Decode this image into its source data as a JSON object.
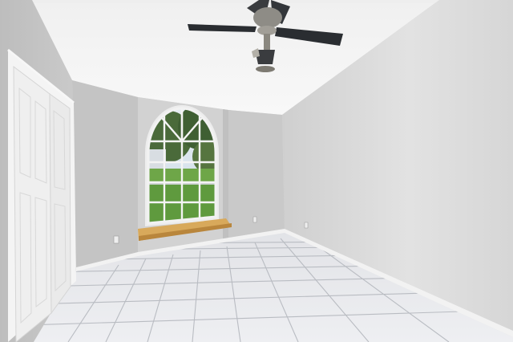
{
  "scene": {
    "subject": "empty-bedroom-interior",
    "colors": {
      "ceiling": "#f4f4f4",
      "wall_right": "#dcdcdc",
      "wall_left": "#c9c9c9",
      "wall_back": "#cfcfcf",
      "floor_tile": "#e9eaee",
      "grout": "#b9bcc2",
      "baseboard": "#f2f2f2",
      "window_sill": "#d8a95b",
      "lawn": "#5f9a3e",
      "tree": "#3f5f33",
      "sky": "#cfe0ee",
      "fan_blade": "#2a2d31",
      "fan_metal": "#8e8c86"
    },
    "icons": [
      "ceiling-fan-icon",
      "outlet-icon"
    ]
  }
}
